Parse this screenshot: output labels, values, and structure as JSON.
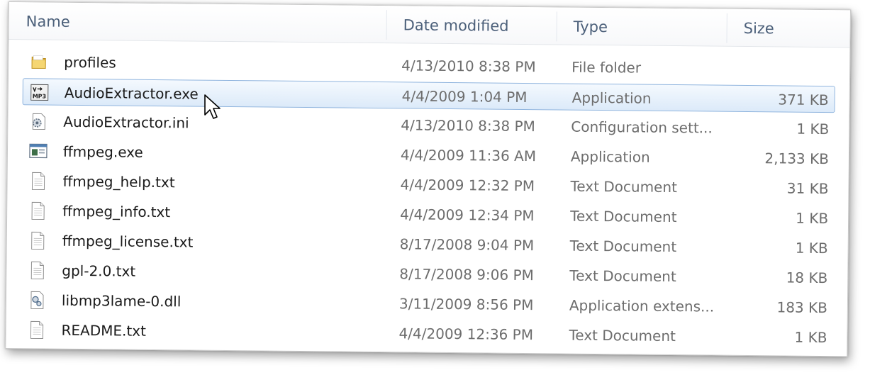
{
  "columns": {
    "name": "Name",
    "date": "Date modified",
    "type": "Type",
    "size": "Size"
  },
  "files": [
    {
      "name": "profiles",
      "date": "4/13/2010 8:38 PM",
      "type": "File folder",
      "size": "",
      "icon": "folder-icon"
    },
    {
      "name": "AudioExtractor.exe",
      "date": "4/4/2009 1:04 PM",
      "type": "Application",
      "size": "371 KB",
      "icon": "mp3-app-icon"
    },
    {
      "name": "AudioExtractor.ini",
      "date": "4/13/2010 8:38 PM",
      "type": "Configuration sett...",
      "size": "1 KB",
      "icon": "config-file-icon"
    },
    {
      "name": "ffmpeg.exe",
      "date": "4/4/2009 11:36 AM",
      "type": "Application",
      "size": "2,133 KB",
      "icon": "application-icon"
    },
    {
      "name": "ffmpeg_help.txt",
      "date": "4/4/2009 12:32 PM",
      "type": "Text Document",
      "size": "31 KB",
      "icon": "text-document-icon"
    },
    {
      "name": "ffmpeg_info.txt",
      "date": "4/4/2009 12:34 PM",
      "type": "Text Document",
      "size": "1 KB",
      "icon": "text-document-icon"
    },
    {
      "name": "ffmpeg_license.txt",
      "date": "8/17/2008 9:04 PM",
      "type": "Text Document",
      "size": "1 KB",
      "icon": "text-document-icon"
    },
    {
      "name": "gpl-2.0.txt",
      "date": "8/17/2008 9:06 PM",
      "type": "Text Document",
      "size": "18 KB",
      "icon": "text-document-icon"
    },
    {
      "name": "libmp3lame-0.dll",
      "date": "3/11/2009 8:56 PM",
      "type": "Application extens...",
      "size": "183 KB",
      "icon": "dll-file-icon"
    },
    {
      "name": "README.txt",
      "date": "4/4/2009 12:36 PM",
      "type": "Text Document",
      "size": "1 KB",
      "icon": "text-document-icon"
    }
  ],
  "selected_index": 1,
  "colors": {
    "header_text": "#4c607a",
    "selection_border": "#8fb4de",
    "selection_fill": "#dceaf9",
    "secondary_text": "#6d6d6d"
  }
}
